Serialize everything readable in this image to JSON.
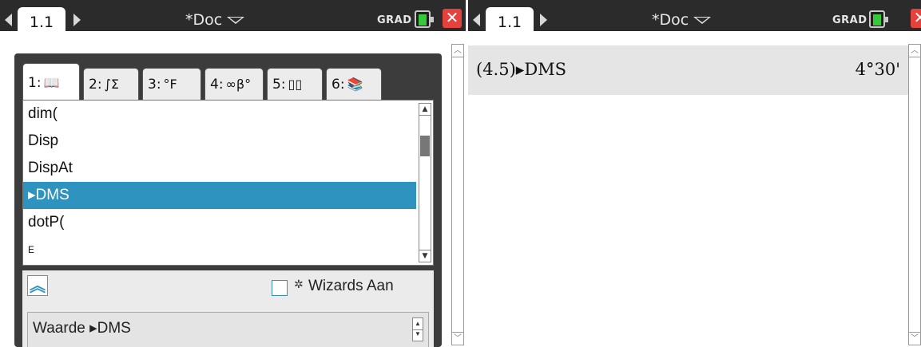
{
  "left_screen": {
    "page_tab": "1.1",
    "doc_title": "*Doc",
    "mode": "GRAD",
    "catalog": {
      "tabs": [
        {
          "number": "1:",
          "icon": "📖"
        },
        {
          "number": "2:",
          "icon": "∫Σ"
        },
        {
          "number": "3:",
          "icon": "°F"
        },
        {
          "number": "4:",
          "icon": "∞β°"
        },
        {
          "number": "5:",
          "icon": "▯▯"
        },
        {
          "number": "6:",
          "icon": "📚"
        }
      ],
      "items": [
        "dim(",
        "Disp",
        "DispAt",
        "▸DMS",
        "dotP(",
        "E"
      ],
      "selected_item": "▸DMS",
      "wizards_label": "Wizards Aan",
      "wizards_checked": false,
      "syntax_text": "Waarde ▸DMS"
    }
  },
  "right_screen": {
    "page_tab": "1.1",
    "doc_title": "*Doc",
    "mode": "GRAD",
    "entry": {
      "expression": "(4.5)▸DMS",
      "result": "4°30'"
    }
  },
  "colors": {
    "topbar": "#2b2b2b",
    "selection": "#2f93c0",
    "close_button": "#e5413d",
    "battery": "#36c93a"
  }
}
